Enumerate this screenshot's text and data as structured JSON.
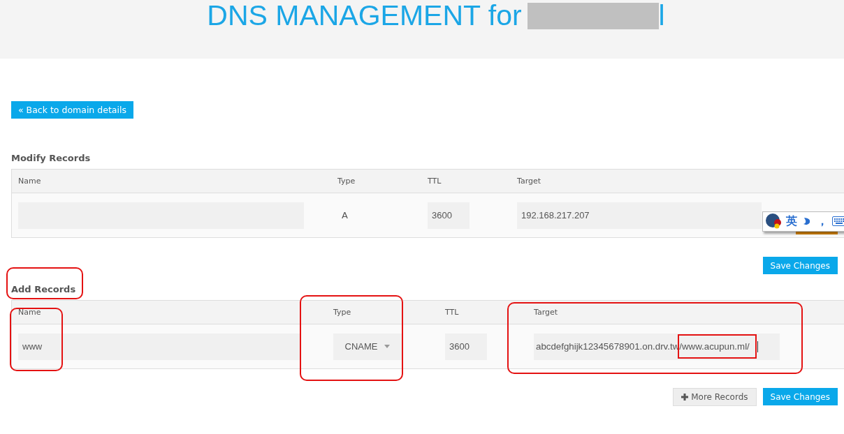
{
  "header": {
    "title": "DNS MANAGEMENT for",
    "title_suffix": "l"
  },
  "back_button": "« Back to domain details",
  "modify": {
    "heading": "Modify Records",
    "columns": [
      "Name",
      "Type",
      "TTL",
      "Target"
    ],
    "row": {
      "type": "A",
      "ttl": "3600",
      "target": "192.168.217.207"
    },
    "ime_toolbar": {
      "language": "英",
      "punctuation": "，"
    },
    "save_button": "Save Changes"
  },
  "add": {
    "heading": "Add Records",
    "heading_highlighted": true,
    "columns": [
      {
        "label": "Name",
        "highlighted": true
      },
      {
        "label": "Type",
        "highlighted": true
      },
      {
        "label": "TTL",
        "highlighted": false
      },
      {
        "label": "Target",
        "highlighted": true
      }
    ],
    "row": {
      "name": "www",
      "type": "CNAME",
      "ttl": "3600",
      "target": "abcdefghijk12345678901.on.drv.tw",
      "target_highlighted_part": "/www.acupun.ml/"
    },
    "more_button": "More Records",
    "save_button": "Save Changes"
  }
}
